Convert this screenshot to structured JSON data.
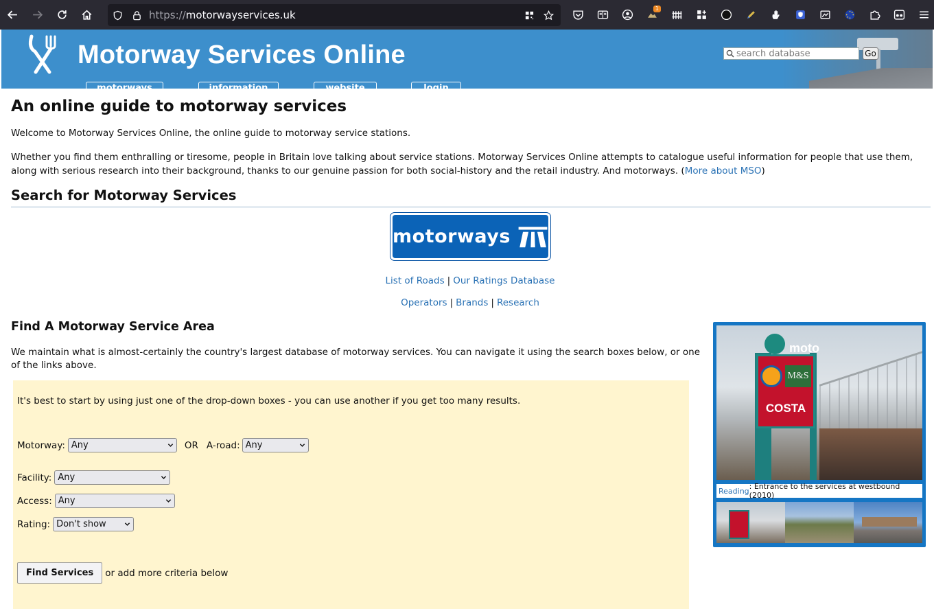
{
  "browser": {
    "url_protocol": "https://",
    "url_host": "motorwayservices.uk",
    "extension_badge": "1",
    "icons": {
      "back": "back-arrow-icon",
      "forward": "forward-arrow-icon",
      "reload": "reload-icon",
      "home": "home-icon",
      "shield": "shield-icon",
      "lock": "lock-icon",
      "qr": "qr-code-icon",
      "bookmark": "star-icon"
    }
  },
  "header": {
    "title": "Motorway Services Online",
    "search_placeholder": "search database",
    "go_label": "Go",
    "tabs": [
      {
        "label": "motorways"
      },
      {
        "label": "information"
      },
      {
        "label": "website"
      },
      {
        "label": "login"
      }
    ],
    "colors": {
      "header_bg": "#3d8fcc",
      "link": "#2a72b5",
      "panel_bg": "#fff5cf",
      "photo_frame": "#1576c4"
    }
  },
  "main": {
    "title": "An online guide to motorway services",
    "intro1": "Welcome to Motorway Services Online, the online guide to motorway service stations.",
    "intro2": "Whether you find them enthralling or tiresome, people in Britain love talking about service stations. Motorway Services Online attempts to catalogue useful information for people that use them, along with serious research into their background, thanks to our genuine passion for both social-history and the retail industry. And motorways. (",
    "intro2_link": "More about MSO",
    "intro2_end": ")",
    "search_section_title": "Search for Motorway Services",
    "sign_text": "motorways",
    "links_row1": [
      "List of Roads",
      "Our Ratings Database"
    ],
    "links_row2": [
      "Operators",
      "Brands",
      "Research"
    ],
    "separator": "|",
    "find_title": "Find A Motorway Service Area",
    "find_desc": "We maintain what is almost-certainly the country's largest database of motorway services. You can navigate it using the search boxes below, or one of the links above.",
    "form": {
      "tip": "It's best to start by using just one of the drop-down boxes - you can use another if you get too many results.",
      "motorway_label": "Motorway:",
      "motorway_value": "Any",
      "or_label": "OR",
      "aroad_label": "A-road:",
      "aroad_value": "Any",
      "facility_label": "Facility:",
      "facility_value": "Any",
      "access_label": "Access:",
      "access_value": "Any",
      "rating_label": "Rating:",
      "rating_value": "Don't show",
      "submit_label": "Find Services",
      "after_submit": "or add more criteria below"
    },
    "photo": {
      "caption_link": "Reading",
      "caption_text": ": Entrance to the services at westbound (2010)",
      "sign_words": [
        "moto",
        "M&S",
        "COSTA"
      ]
    }
  }
}
